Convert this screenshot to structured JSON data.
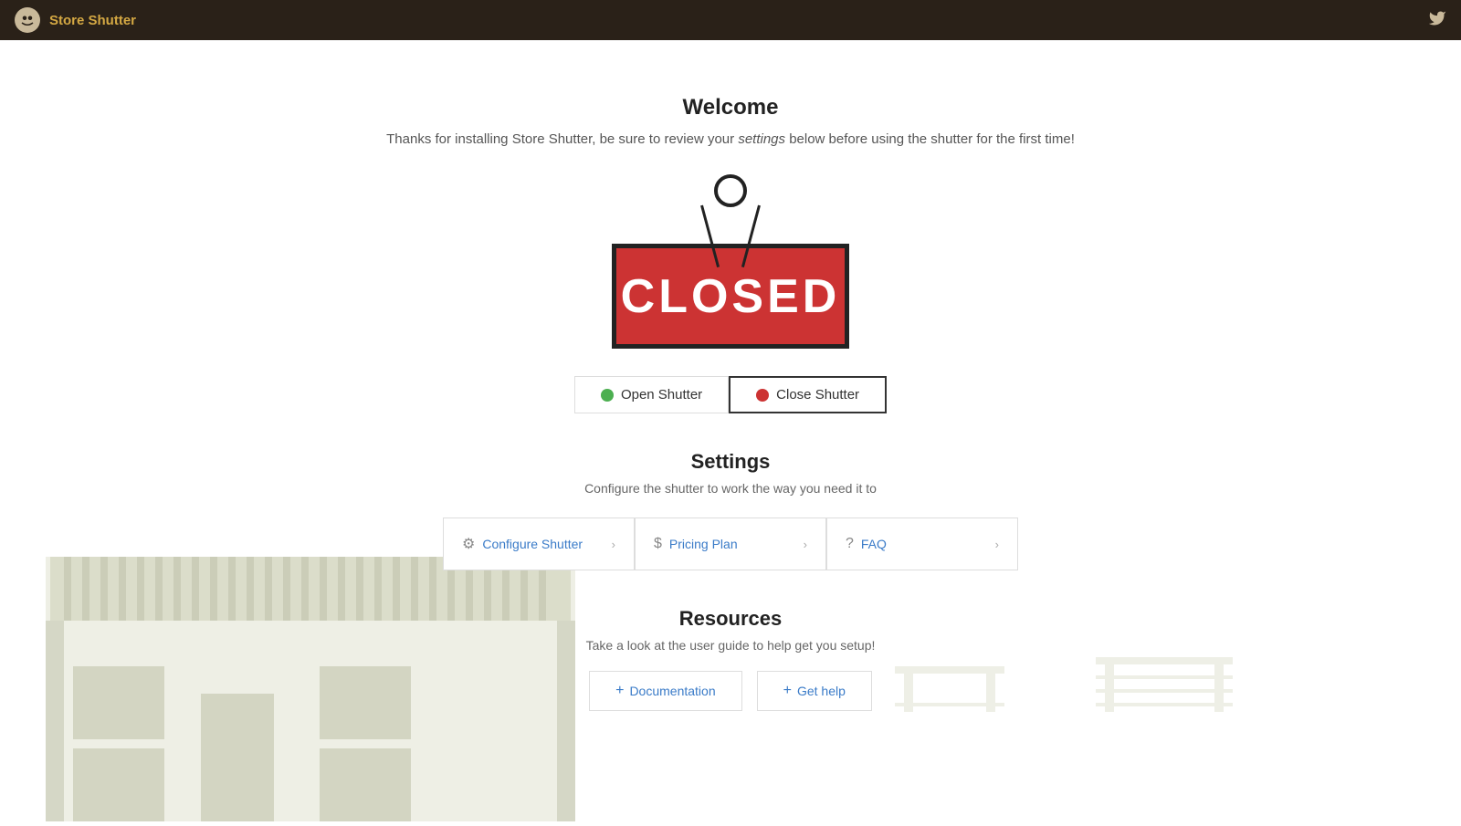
{
  "header": {
    "logo_alt": "Store Shutter logo",
    "title": "Store Shutter",
    "twitter_icon": "🐦"
  },
  "welcome": {
    "title": "Welcome",
    "subtitle_start": "Thanks for installing Store Shutter, be sure to review your ",
    "subtitle_italic": "settings",
    "subtitle_end": " below before using the shutter for the first time!"
  },
  "sign": {
    "text": "CLOSED"
  },
  "buttons": {
    "open_label": "Open Shutter",
    "close_label": "Close Shutter"
  },
  "settings": {
    "title": "Settings",
    "subtitle": "Configure the shutter to work the way you need it to",
    "cards": [
      {
        "icon": "⚙",
        "label": "Configure Shutter"
      },
      {
        "icon": "$",
        "label": "Pricing Plan"
      },
      {
        "icon": "?",
        "label": "FAQ"
      }
    ]
  },
  "resources": {
    "title": "Resources",
    "subtitle": "Take a look at the user guide to help get you setup!",
    "buttons": [
      {
        "label": "Documentation"
      },
      {
        "label": "Get help"
      }
    ]
  }
}
